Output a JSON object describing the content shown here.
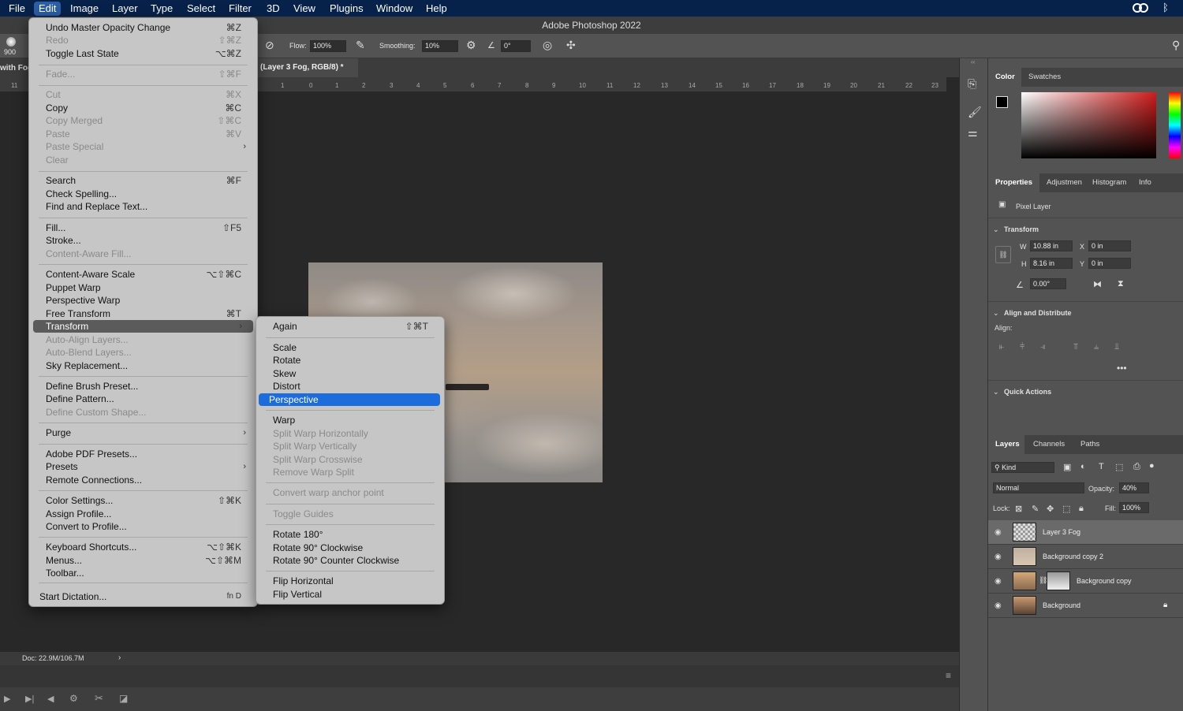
{
  "macbar": {
    "items": [
      "File",
      "Edit",
      "Image",
      "Layer",
      "Type",
      "Select",
      "Filter",
      "3D",
      "View",
      "Plugins",
      "Window",
      "Help"
    ],
    "active": "Edit"
  },
  "app": {
    "title": "Adobe Photoshop 2022"
  },
  "options": {
    "brush_size": "900",
    "flow_label": "Flow:",
    "flow_value": "100%",
    "smoothing_label": "Smoothing:",
    "smoothing_value": "10%",
    "angle_value": "0°"
  },
  "document": {
    "tab_left": "with Fog",
    "tab_label": "(Layer 3 Fog, RGB/8) *",
    "status": "Doc: 22.9M/106.7M"
  },
  "ruler": {
    "ticks": [
      "11",
      "1",
      "0",
      "1",
      "2",
      "3",
      "4",
      "5",
      "6",
      "7",
      "8",
      "9",
      "10",
      "11",
      "12",
      "13",
      "14",
      "15",
      "16",
      "17",
      "18",
      "19",
      "20",
      "21",
      "22",
      "23"
    ]
  },
  "edit_menu": {
    "items": [
      {
        "label": "Undo Master Opacity Change",
        "shortcut": "⌘Z",
        "disabled": false
      },
      {
        "label": "Redo",
        "shortcut": "⇧⌘Z",
        "disabled": true
      },
      {
        "label": "Toggle Last State",
        "shortcut": "⌥⌘Z",
        "disabled": false
      },
      {
        "label": "Fade...",
        "shortcut": "⇧⌘F",
        "disabled": true
      },
      {
        "label": "Cut",
        "shortcut": "⌘X",
        "disabled": true
      },
      {
        "label": "Copy",
        "shortcut": "⌘C",
        "disabled": false
      },
      {
        "label": "Copy Merged",
        "shortcut": "⇧⌘C",
        "disabled": true
      },
      {
        "label": "Paste",
        "shortcut": "⌘V",
        "disabled": true
      },
      {
        "label": "Paste Special",
        "shortcut": "",
        "disabled": true
      },
      {
        "label": "Clear",
        "shortcut": "",
        "disabled": true
      },
      {
        "label": "Search",
        "shortcut": "⌘F",
        "disabled": false
      },
      {
        "label": "Check Spelling...",
        "shortcut": "",
        "disabled": false
      },
      {
        "label": "Find and Replace Text...",
        "shortcut": "",
        "disabled": false
      },
      {
        "label": "Fill...",
        "shortcut": "⇧F5",
        "disabled": false
      },
      {
        "label": "Stroke...",
        "shortcut": "",
        "disabled": false
      },
      {
        "label": "Content-Aware Fill...",
        "shortcut": "",
        "disabled": true
      },
      {
        "label": "Content-Aware Scale",
        "shortcut": "⌥⇧⌘C",
        "disabled": false
      },
      {
        "label": "Puppet Warp",
        "shortcut": "",
        "disabled": false
      },
      {
        "label": "Perspective Warp",
        "shortcut": "",
        "disabled": false
      },
      {
        "label": "Free Transform",
        "shortcut": "⌘T",
        "disabled": false
      },
      {
        "label": "Transform",
        "shortcut": "",
        "disabled": false
      },
      {
        "label": "Auto-Align Layers...",
        "shortcut": "",
        "disabled": true
      },
      {
        "label": "Auto-Blend Layers...",
        "shortcut": "",
        "disabled": true
      },
      {
        "label": "Sky Replacement...",
        "shortcut": "",
        "disabled": false
      },
      {
        "label": "Define Brush Preset...",
        "shortcut": "",
        "disabled": false
      },
      {
        "label": "Define Pattern...",
        "shortcut": "",
        "disabled": false
      },
      {
        "label": "Define Custom Shape...",
        "shortcut": "",
        "disabled": true
      },
      {
        "label": "Purge",
        "shortcut": "",
        "disabled": false
      },
      {
        "label": "Adobe PDF Presets...",
        "shortcut": "",
        "disabled": false
      },
      {
        "label": "Presets",
        "shortcut": "",
        "disabled": false
      },
      {
        "label": "Remote Connections...",
        "shortcut": "",
        "disabled": false
      },
      {
        "label": "Color Settings...",
        "shortcut": "⇧⌘K",
        "disabled": false
      },
      {
        "label": "Assign Profile...",
        "shortcut": "",
        "disabled": false
      },
      {
        "label": "Convert to Profile...",
        "shortcut": "",
        "disabled": false
      },
      {
        "label": "Keyboard Shortcuts...",
        "shortcut": "⌥⇧⌘K",
        "disabled": false
      },
      {
        "label": "Menus...",
        "shortcut": "⌥⇧⌘M",
        "disabled": false
      },
      {
        "label": "Toolbar...",
        "shortcut": "",
        "disabled": false
      },
      {
        "label": "Start Dictation...",
        "shortcut": "fn D",
        "disabled": false
      }
    ]
  },
  "transform_menu": {
    "items": [
      {
        "label": "Again",
        "shortcut": "⇧⌘T",
        "disabled": false
      },
      {
        "label": "Scale",
        "shortcut": "",
        "disabled": false
      },
      {
        "label": "Rotate",
        "shortcut": "",
        "disabled": false
      },
      {
        "label": "Skew",
        "shortcut": "",
        "disabled": false
      },
      {
        "label": "Distort",
        "shortcut": "",
        "disabled": false
      },
      {
        "label": "Perspective",
        "shortcut": "",
        "disabled": false
      },
      {
        "label": "Warp",
        "shortcut": "",
        "disabled": false
      },
      {
        "label": "Split Warp Horizontally",
        "shortcut": "",
        "disabled": true
      },
      {
        "label": "Split Warp Vertically",
        "shortcut": "",
        "disabled": true
      },
      {
        "label": "Split Warp Crosswise",
        "shortcut": "",
        "disabled": true
      },
      {
        "label": "Remove Warp Split",
        "shortcut": "",
        "disabled": true
      },
      {
        "label": "Convert warp anchor point",
        "shortcut": "",
        "disabled": true
      },
      {
        "label": "Toggle Guides",
        "shortcut": "",
        "disabled": true
      },
      {
        "label": "Rotate 180°",
        "shortcut": "",
        "disabled": false
      },
      {
        "label": "Rotate 90° Clockwise",
        "shortcut": "",
        "disabled": false
      },
      {
        "label": "Rotate 90° Counter Clockwise",
        "shortcut": "",
        "disabled": false
      },
      {
        "label": "Flip Horizontal",
        "shortcut": "",
        "disabled": false
      },
      {
        "label": "Flip Vertical",
        "shortcut": "",
        "disabled": false
      }
    ]
  },
  "color_panel": {
    "tabs": [
      "Color",
      "Swatches"
    ],
    "accent": "#d01c1c"
  },
  "properties_panel": {
    "tabs": [
      "Properties",
      "Adjustmen",
      "Histogram",
      "Info"
    ],
    "kind": "Pixel Layer",
    "transform_title": "Transform",
    "w_label": "W",
    "w_value": "10.88 in",
    "x_label": "X",
    "x_value": "0 in",
    "h_label": "H",
    "h_value": "8.16 in",
    "y_label": "Y",
    "y_value": "0 in",
    "angle_value": "0.00°",
    "align_title": "Align and Distribute",
    "align_label": "Align:",
    "quick_title": "Quick Actions"
  },
  "layers_panel": {
    "tabs": [
      "Layers",
      "Channels",
      "Paths"
    ],
    "kind_filter": "Kind",
    "blend_mode": "Normal",
    "opacity_label": "Opacity:",
    "opacity_value": "40%",
    "lock_label": "Lock:",
    "fill_label": "Fill:",
    "fill_value": "100%",
    "layers": [
      {
        "name": "Layer 3 Fog",
        "selected": true
      },
      {
        "name": "Background copy 2",
        "selected": false
      },
      {
        "name": "Background copy",
        "selected": false
      },
      {
        "name": "Background",
        "selected": false
      }
    ]
  }
}
